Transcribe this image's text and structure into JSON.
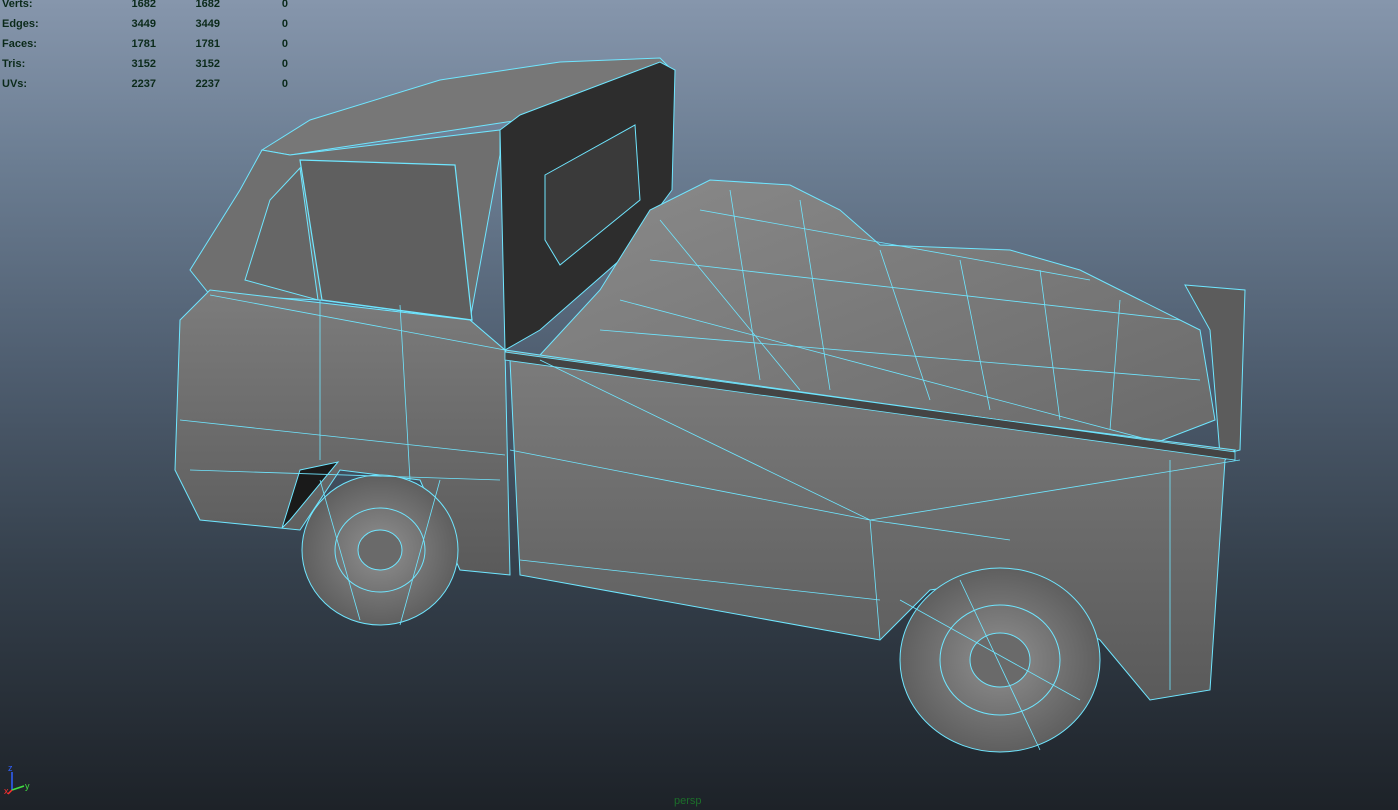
{
  "hud": {
    "rows": [
      {
        "label": "Verts:",
        "a": "1682",
        "b": "1682",
        "c": "0"
      },
      {
        "label": "Edges:",
        "a": "3449",
        "b": "3449",
        "c": "0"
      },
      {
        "label": "Faces:",
        "a": "1781",
        "b": "1781",
        "c": "0"
      },
      {
        "label": "Tris:",
        "a": "3152",
        "b": "3152",
        "c": "0"
      },
      {
        "label": "UVs:",
        "a": "2237",
        "b": "2237",
        "c": "0"
      }
    ]
  },
  "axis": {
    "x": "x",
    "y": "y",
    "z": "z"
  },
  "camera": "persp",
  "colors": {
    "wire": "#6fe6ff",
    "axis_x": "#ff3030",
    "axis_y": "#40e040",
    "axis_z": "#3060ff",
    "hud_text": "#0b2a1a"
  }
}
